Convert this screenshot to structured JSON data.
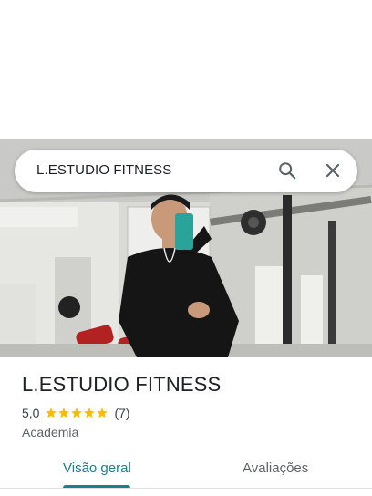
{
  "search": {
    "query": "L.ESTUDIO FITNESS"
  },
  "place": {
    "name": "L.ESTUDIO FITNESS",
    "rating": "5,0",
    "stars": 5,
    "review_count": "(7)",
    "category": "Academia"
  },
  "tabs": [
    {
      "label": "Visão geral",
      "active": true
    },
    {
      "label": "Avaliações",
      "active": false
    }
  ],
  "colors": {
    "accent": "#1a7f8a",
    "star": "#fbbc04",
    "title": "#202124"
  },
  "icons": [
    "search-icon",
    "close-icon",
    "star-icon"
  ]
}
